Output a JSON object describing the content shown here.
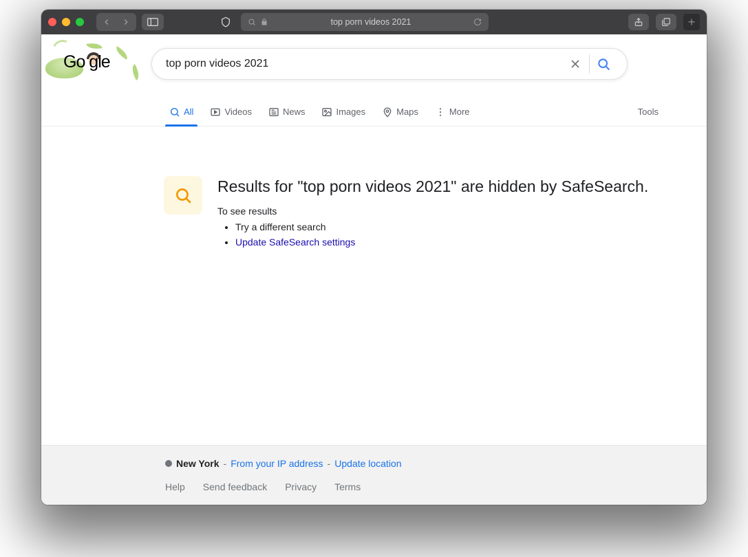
{
  "browser": {
    "url_display": "top porn videos 2021"
  },
  "search": {
    "query": "top porn videos 2021"
  },
  "tabs": {
    "items": [
      {
        "label": "All"
      },
      {
        "label": "Videos"
      },
      {
        "label": "News"
      },
      {
        "label": "Images"
      },
      {
        "label": "Maps"
      },
      {
        "label": "More"
      }
    ],
    "tools_label": "Tools"
  },
  "safesearch": {
    "heading": "Results for \"top porn videos 2021\" are hidden by SafeSearch.",
    "subheading": "To see results",
    "bullets": [
      "Try a different search",
      "Update SafeSearch settings"
    ]
  },
  "footer": {
    "location_name": "New York",
    "location_dash": " - ",
    "from_ip": "From your IP address",
    "dash2": " - ",
    "update_loc": "Update location",
    "links": [
      "Help",
      "Send feedback",
      "Privacy",
      "Terms"
    ]
  }
}
